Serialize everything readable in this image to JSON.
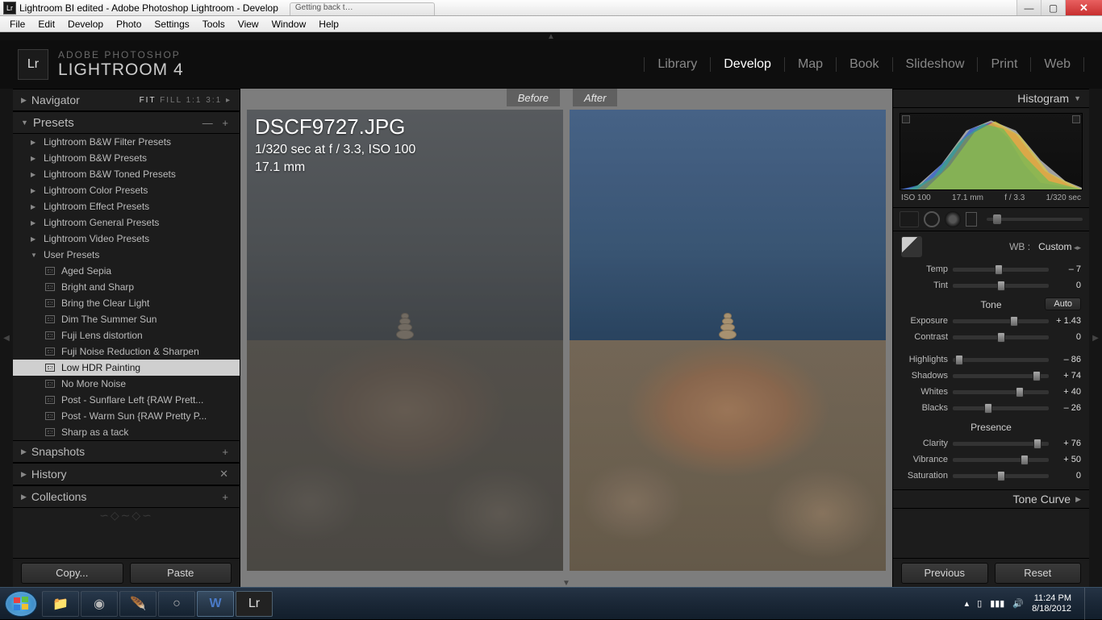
{
  "window": {
    "title": "Lightroom BI edited - Adobe Photoshop Lightroom - Develop",
    "browser_tab": "Getting back t…"
  },
  "menubar": [
    "File",
    "Edit",
    "Develop",
    "Photo",
    "Settings",
    "Tools",
    "View",
    "Window",
    "Help"
  ],
  "brand": {
    "logo": "Lr",
    "line1": "ADOBE PHOTOSHOP",
    "line2": "LIGHTROOM 4"
  },
  "modules": [
    "Library",
    "Develop",
    "Map",
    "Book",
    "Slideshow",
    "Print",
    "Web"
  ],
  "active_module": "Develop",
  "left": {
    "navigator": {
      "label": "Navigator",
      "opts": [
        "FIT",
        "FILL",
        "1:1",
        "3:1"
      ],
      "sel": "FIT"
    },
    "presets_hdr": "Presets",
    "preset_groups": [
      "Lightroom B&W Filter Presets",
      "Lightroom B&W Presets",
      "Lightroom B&W Toned Presets",
      "Lightroom Color Presets",
      "Lightroom Effect Presets",
      "Lightroom General Presets",
      "Lightroom Video Presets"
    ],
    "user_group": "User Presets",
    "user_presets": [
      "Aged Sepia",
      "Bright and Sharp",
      "Bring the Clear Light",
      "Dim The Summer Sun",
      "Fuji Lens distortion",
      "Fuji Noise Reduction & Sharpen",
      "Low HDR Painting",
      "No More Noise",
      "Post - Sunflare Left {RAW Prett...",
      "Post - Warm Sun {RAW Pretty P...",
      "Sharp as a tack"
    ],
    "selected_preset": "Low HDR Painting",
    "snapshots": "Snapshots",
    "history": "History",
    "collections": "Collections",
    "copy": "Copy...",
    "paste": "Paste"
  },
  "center": {
    "before": "Before",
    "after": "After",
    "filename": "DSCF9727.JPG",
    "meta1": "1/320 sec at f / 3.3, ISO 100",
    "meta2": "17.1 mm"
  },
  "right": {
    "histogram": "Histogram",
    "hist_info": {
      "iso": "ISO 100",
      "focal": "17.1 mm",
      "ap": "f / 3.3",
      "sh": "1/320 sec"
    },
    "wb_label": "WB :",
    "wb_value": "Custom",
    "tone": "Tone",
    "auto": "Auto",
    "presence": "Presence",
    "tonecurve": "Tone Curve",
    "sliders": {
      "temp": {
        "label": "Temp",
        "val": "– 7",
        "pos": 48
      },
      "tint": {
        "label": "Tint",
        "val": "0",
        "pos": 50
      },
      "exposure": {
        "label": "Exposure",
        "val": "+ 1.43",
        "pos": 64
      },
      "contrast": {
        "label": "Contrast",
        "val": "0",
        "pos": 50
      },
      "highlights": {
        "label": "Highlights",
        "val": "– 86",
        "pos": 7
      },
      "shadows": {
        "label": "Shadows",
        "val": "+ 74",
        "pos": 87
      },
      "whites": {
        "label": "Whites",
        "val": "+ 40",
        "pos": 70
      },
      "blacks": {
        "label": "Blacks",
        "val": "– 26",
        "pos": 37
      },
      "clarity": {
        "label": "Clarity",
        "val": "+ 76",
        "pos": 88
      },
      "vibrance": {
        "label": "Vibrance",
        "val": "+ 50",
        "pos": 75
      },
      "saturation": {
        "label": "Saturation",
        "val": "0",
        "pos": 50
      }
    },
    "previous": "Previous",
    "reset": "Reset"
  },
  "taskbar": {
    "time": "11:24 PM",
    "date": "8/18/2012"
  }
}
